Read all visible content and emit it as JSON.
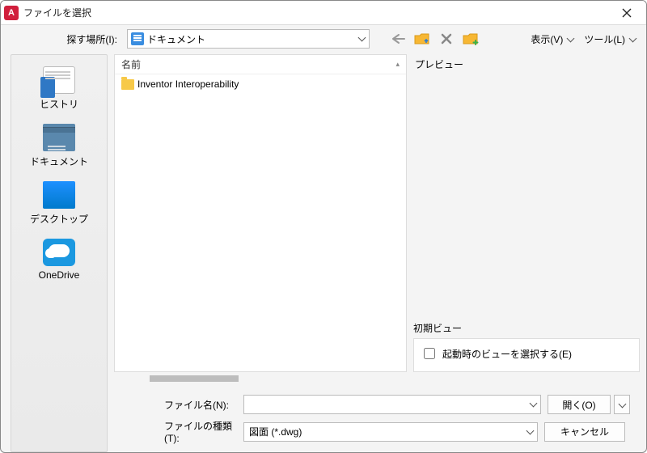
{
  "titlebar": {
    "title": "ファイルを選択"
  },
  "toolbar": {
    "lookin_label": "探す場所(I):",
    "lookin_value": "ドキュメント",
    "view_label": "表示(V)",
    "tools_label": "ツール(L)"
  },
  "places": {
    "history": "ヒストリ",
    "documents": "ドキュメント",
    "desktop": "デスクトップ",
    "onedrive": "OneDrive"
  },
  "filelist": {
    "col_name": "名前",
    "items": [
      {
        "name": "Inventor Interoperability",
        "type": "folder"
      }
    ]
  },
  "preview": {
    "label": "プレビュー"
  },
  "initview": {
    "group_label": "初期ビュー",
    "checkbox_label": "起動時のビューを選択する(E)",
    "checked": false
  },
  "bottom": {
    "filename_label": "ファイル名(N):",
    "filename_value": "",
    "filetype_label": "ファイルの種類(T):",
    "filetype_value": "図面 (*.dwg)",
    "open_label": "開く(O)",
    "cancel_label": "キャンセル"
  }
}
